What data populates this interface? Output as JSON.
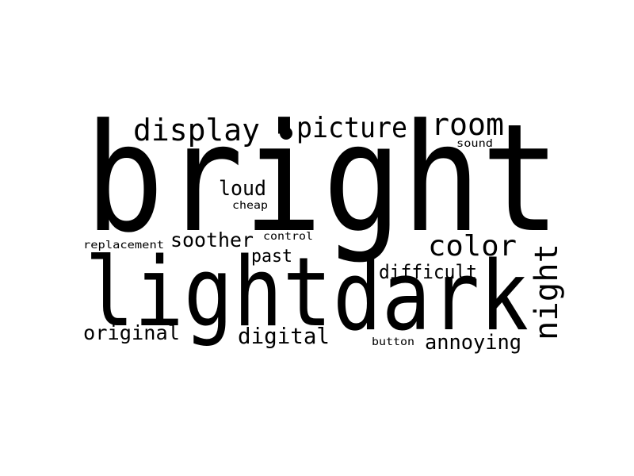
{
  "wordcloud": {
    "text_color": "#000000",
    "background_color": "#ffffff",
    "words": [
      {
        "text": "bright"
      },
      {
        "text": "light"
      },
      {
        "text": "dark"
      },
      {
        "text": "display"
      },
      {
        "text": "picture"
      },
      {
        "text": "room"
      },
      {
        "text": "sound"
      },
      {
        "text": "loud"
      },
      {
        "text": "cheap"
      },
      {
        "text": "color"
      },
      {
        "text": "night"
      },
      {
        "text": "replacement"
      },
      {
        "text": "soother"
      },
      {
        "text": "control"
      },
      {
        "text": "past"
      },
      {
        "text": "difficult"
      },
      {
        "text": "original"
      },
      {
        "text": "digital"
      },
      {
        "text": "button"
      },
      {
        "text": "annoying"
      }
    ]
  }
}
